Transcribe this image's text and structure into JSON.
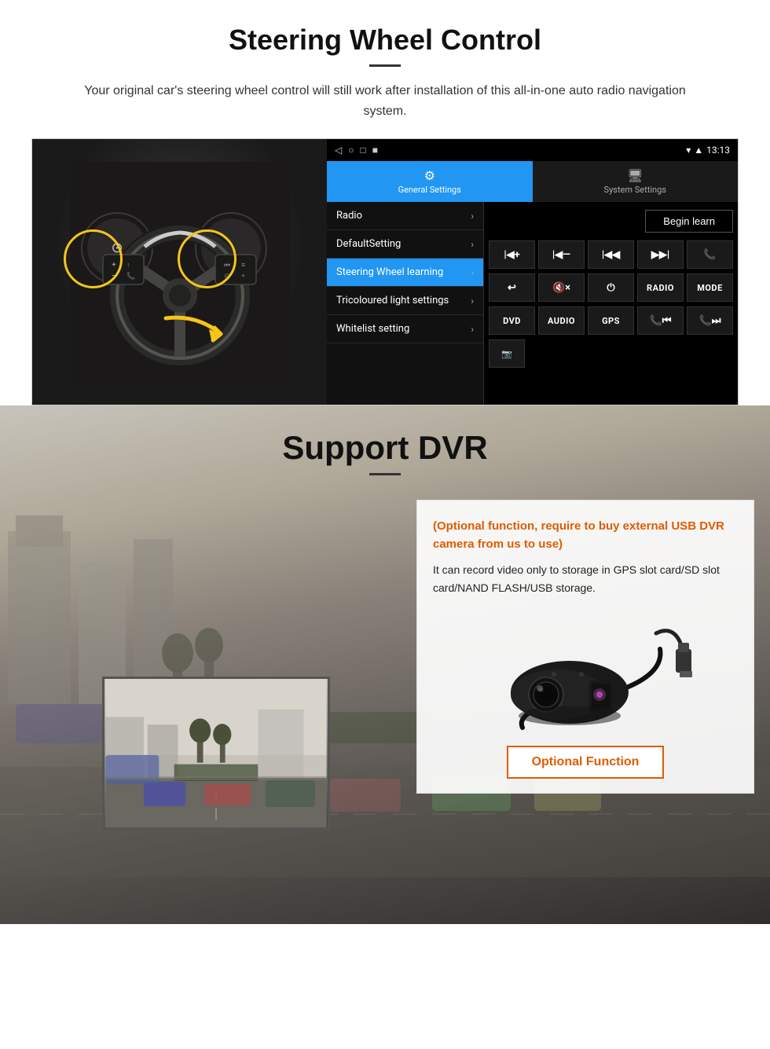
{
  "steering": {
    "title": "Steering Wheel Control",
    "subtitle": "Your original car's steering wheel control will still work after installation of this all-in-one auto radio navigation system.",
    "tabs": {
      "general": "General Settings",
      "system": "System Settings"
    },
    "menu": {
      "items": [
        {
          "label": "Radio",
          "active": false
        },
        {
          "label": "DefaultSetting",
          "active": false
        },
        {
          "label": "Steering Wheel learning",
          "active": true
        },
        {
          "label": "Tricoloured light settings",
          "active": false
        },
        {
          "label": "Whitelist setting",
          "active": false
        }
      ]
    },
    "begin_learn": "Begin learn",
    "controls": [
      "⏮+",
      "⏮—",
      "⏮|",
      "|⏭",
      "📞",
      "↩",
      "🔇x",
      "⏻",
      "RADIO",
      "MODE",
      "DVD",
      "AUDIO",
      "GPS",
      "📞⏮|",
      "📞⏭"
    ],
    "extra": "⏺",
    "statusbar": {
      "time": "13:13",
      "nav_icons": [
        "◁",
        "○",
        "□",
        "■"
      ]
    }
  },
  "dvr": {
    "title": "Support DVR",
    "optional_text": "(Optional function, require to buy external USB DVR camera from us to use)",
    "description": "It can record video only to storage in GPS slot card/SD slot card/NAND FLASH/USB storage.",
    "optional_btn": "Optional Function"
  }
}
